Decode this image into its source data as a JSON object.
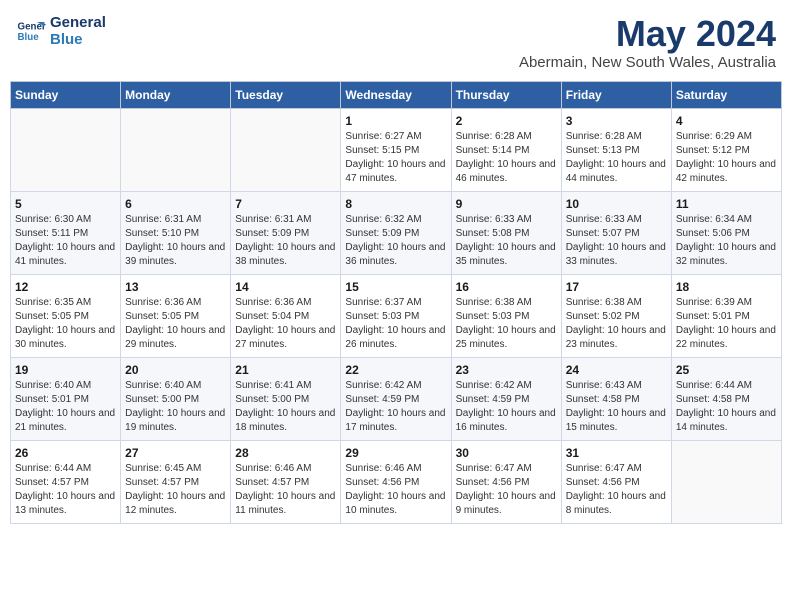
{
  "header": {
    "logo_line1": "General",
    "logo_line2": "Blue",
    "main_title": "May 2024",
    "subtitle": "Abermain, New South Wales, Australia"
  },
  "days_of_week": [
    "Sunday",
    "Monday",
    "Tuesday",
    "Wednesday",
    "Thursday",
    "Friday",
    "Saturday"
  ],
  "weeks": [
    [
      {
        "day": "",
        "info": ""
      },
      {
        "day": "",
        "info": ""
      },
      {
        "day": "",
        "info": ""
      },
      {
        "day": "1",
        "info": "Sunrise: 6:27 AM\nSunset: 5:15 PM\nDaylight: 10 hours and 47 minutes."
      },
      {
        "day": "2",
        "info": "Sunrise: 6:28 AM\nSunset: 5:14 PM\nDaylight: 10 hours and 46 minutes."
      },
      {
        "day": "3",
        "info": "Sunrise: 6:28 AM\nSunset: 5:13 PM\nDaylight: 10 hours and 44 minutes."
      },
      {
        "day": "4",
        "info": "Sunrise: 6:29 AM\nSunset: 5:12 PM\nDaylight: 10 hours and 42 minutes."
      }
    ],
    [
      {
        "day": "5",
        "info": "Sunrise: 6:30 AM\nSunset: 5:11 PM\nDaylight: 10 hours and 41 minutes."
      },
      {
        "day": "6",
        "info": "Sunrise: 6:31 AM\nSunset: 5:10 PM\nDaylight: 10 hours and 39 minutes."
      },
      {
        "day": "7",
        "info": "Sunrise: 6:31 AM\nSunset: 5:09 PM\nDaylight: 10 hours and 38 minutes."
      },
      {
        "day": "8",
        "info": "Sunrise: 6:32 AM\nSunset: 5:09 PM\nDaylight: 10 hours and 36 minutes."
      },
      {
        "day": "9",
        "info": "Sunrise: 6:33 AM\nSunset: 5:08 PM\nDaylight: 10 hours and 35 minutes."
      },
      {
        "day": "10",
        "info": "Sunrise: 6:33 AM\nSunset: 5:07 PM\nDaylight: 10 hours and 33 minutes."
      },
      {
        "day": "11",
        "info": "Sunrise: 6:34 AM\nSunset: 5:06 PM\nDaylight: 10 hours and 32 minutes."
      }
    ],
    [
      {
        "day": "12",
        "info": "Sunrise: 6:35 AM\nSunset: 5:05 PM\nDaylight: 10 hours and 30 minutes."
      },
      {
        "day": "13",
        "info": "Sunrise: 6:36 AM\nSunset: 5:05 PM\nDaylight: 10 hours and 29 minutes."
      },
      {
        "day": "14",
        "info": "Sunrise: 6:36 AM\nSunset: 5:04 PM\nDaylight: 10 hours and 27 minutes."
      },
      {
        "day": "15",
        "info": "Sunrise: 6:37 AM\nSunset: 5:03 PM\nDaylight: 10 hours and 26 minutes."
      },
      {
        "day": "16",
        "info": "Sunrise: 6:38 AM\nSunset: 5:03 PM\nDaylight: 10 hours and 25 minutes."
      },
      {
        "day": "17",
        "info": "Sunrise: 6:38 AM\nSunset: 5:02 PM\nDaylight: 10 hours and 23 minutes."
      },
      {
        "day": "18",
        "info": "Sunrise: 6:39 AM\nSunset: 5:01 PM\nDaylight: 10 hours and 22 minutes."
      }
    ],
    [
      {
        "day": "19",
        "info": "Sunrise: 6:40 AM\nSunset: 5:01 PM\nDaylight: 10 hours and 21 minutes."
      },
      {
        "day": "20",
        "info": "Sunrise: 6:40 AM\nSunset: 5:00 PM\nDaylight: 10 hours and 19 minutes."
      },
      {
        "day": "21",
        "info": "Sunrise: 6:41 AM\nSunset: 5:00 PM\nDaylight: 10 hours and 18 minutes."
      },
      {
        "day": "22",
        "info": "Sunrise: 6:42 AM\nSunset: 4:59 PM\nDaylight: 10 hours and 17 minutes."
      },
      {
        "day": "23",
        "info": "Sunrise: 6:42 AM\nSunset: 4:59 PM\nDaylight: 10 hours and 16 minutes."
      },
      {
        "day": "24",
        "info": "Sunrise: 6:43 AM\nSunset: 4:58 PM\nDaylight: 10 hours and 15 minutes."
      },
      {
        "day": "25",
        "info": "Sunrise: 6:44 AM\nSunset: 4:58 PM\nDaylight: 10 hours and 14 minutes."
      }
    ],
    [
      {
        "day": "26",
        "info": "Sunrise: 6:44 AM\nSunset: 4:57 PM\nDaylight: 10 hours and 13 minutes."
      },
      {
        "day": "27",
        "info": "Sunrise: 6:45 AM\nSunset: 4:57 PM\nDaylight: 10 hours and 12 minutes."
      },
      {
        "day": "28",
        "info": "Sunrise: 6:46 AM\nSunset: 4:57 PM\nDaylight: 10 hours and 11 minutes."
      },
      {
        "day": "29",
        "info": "Sunrise: 6:46 AM\nSunset: 4:56 PM\nDaylight: 10 hours and 10 minutes."
      },
      {
        "day": "30",
        "info": "Sunrise: 6:47 AM\nSunset: 4:56 PM\nDaylight: 10 hours and 9 minutes."
      },
      {
        "day": "31",
        "info": "Sunrise: 6:47 AM\nSunset: 4:56 PM\nDaylight: 10 hours and 8 minutes."
      },
      {
        "day": "",
        "info": ""
      }
    ]
  ]
}
